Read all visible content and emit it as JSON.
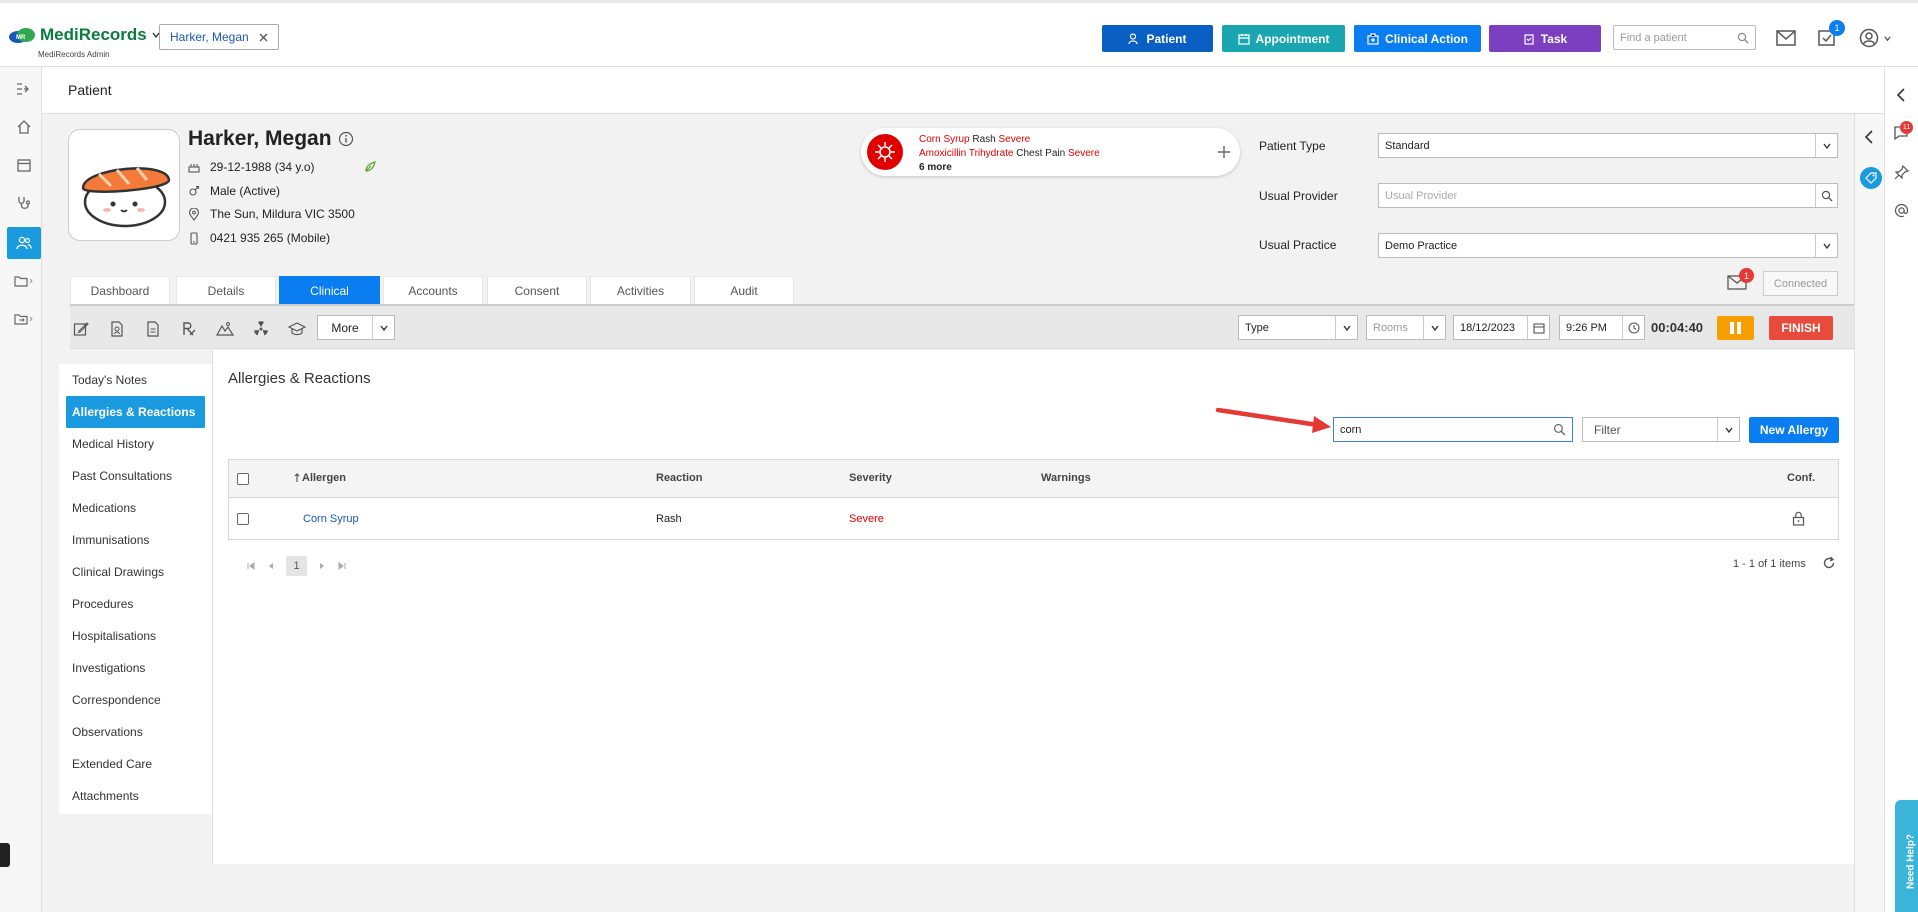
{
  "app": {
    "logo_brand": "MediRecords",
    "logo_sub": "MediRecords Admin",
    "open_tab": "Harker, Megan"
  },
  "top_actions": {
    "patient": "Patient",
    "appointment": "Appointment",
    "clinical_action": "Clinical Action",
    "task": "Task",
    "find_patient_placeholder": "Find a patient",
    "task_badge": "1"
  },
  "page": {
    "title": "Patient"
  },
  "patient": {
    "name": "Harker, Megan",
    "dob": "29-12-1988 (34 y.o)",
    "gender": "Male (Active)",
    "address": "The Sun, Mildura VIC 3500",
    "phone": "0421 935 265 (Mobile)"
  },
  "allergy_summary": {
    "line1": {
      "allergen": "Corn Syrup",
      "reaction": "Rash",
      "severity": "Severe"
    },
    "line2": {
      "allergen": "Amoxicillin Trihydrate",
      "reaction": "Chest Pain",
      "severity": "Severe"
    },
    "more": "6 more"
  },
  "patient_fields": {
    "type_label": "Patient Type",
    "type_value": "Standard",
    "provider_label": "Usual Provider",
    "provider_placeholder": "Usual Provider",
    "practice_label": "Usual Practice",
    "practice_value": "Demo Practice"
  },
  "tabs": [
    "Dashboard",
    "Details",
    "Clinical",
    "Accounts",
    "Consent",
    "Activities",
    "Audit"
  ],
  "messages": {
    "badge": "1",
    "status": "Connected"
  },
  "toolbar": {
    "more": "More",
    "type_placeholder": "Type",
    "rooms_placeholder": "Rooms",
    "date": "18/12/2023",
    "time": "9:26 PM",
    "timer": "00:04:40",
    "finish": "FINISH"
  },
  "side_menu": [
    "Today's Notes",
    "Allergies & Reactions",
    "Medical History",
    "Past Consultations",
    "Medications",
    "Immunisations",
    "Clinical Drawings",
    "Procedures",
    "Hospitalisations",
    "Investigations",
    "Correspondence",
    "Observations",
    "Extended Care",
    "Attachments"
  ],
  "allergies": {
    "heading": "Allergies & Reactions",
    "search_value": "corn",
    "filter_placeholder": "Filter",
    "new_button": "New Allergy",
    "columns": {
      "allergen": "Allergen",
      "reaction": "Reaction",
      "severity": "Severity",
      "warnings": "Warnings",
      "conf": "Conf."
    },
    "rows": [
      {
        "allergen": "Corn Syrup",
        "reaction": "Rash",
        "severity": "Severe",
        "warnings": ""
      }
    ],
    "pager_page": "1",
    "pager_summary": "1 - 1 of 1 items"
  },
  "right_rail": {
    "notifications_badge": "11",
    "help": "Need Help?"
  },
  "colors": {
    "patient_btn": "#0a5fc4",
    "appointment_btn": "#1aa6b0",
    "clinical_btn": "#0a7df0",
    "task_btn": "#7b3fbf",
    "accent": "#1a9be0",
    "severe": "#e00000",
    "pause": "#f5a000",
    "finish": "#e84a3c",
    "arrow": "#e53935"
  }
}
